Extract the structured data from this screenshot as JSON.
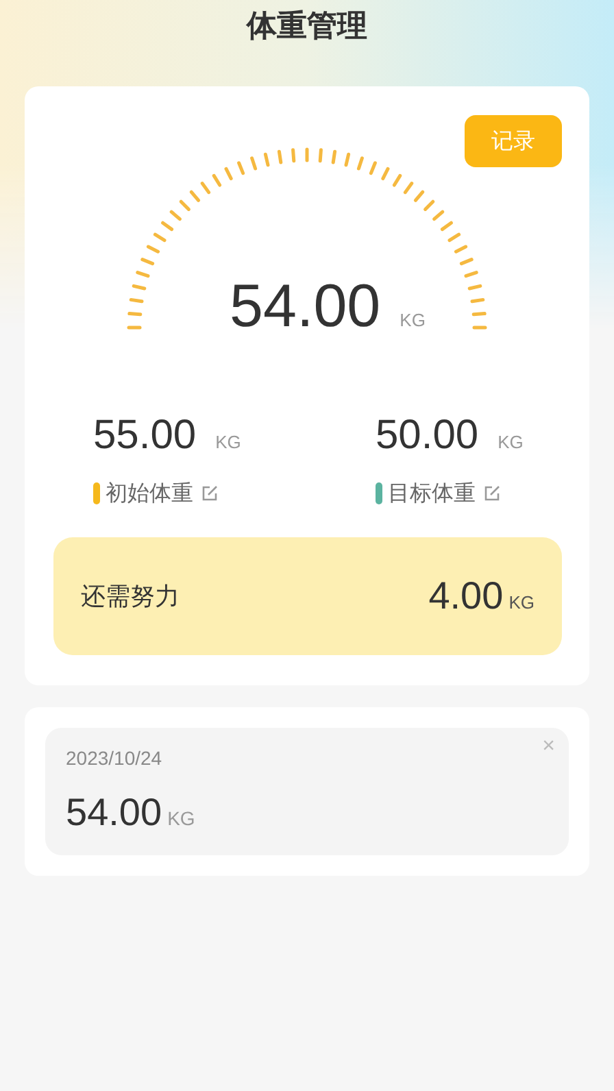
{
  "title": "体重管理",
  "record_button": "记录",
  "current": {
    "value": "54.00",
    "unit": "KG"
  },
  "stats": [
    {
      "value": "55.00",
      "unit": "KG",
      "label": "初始体重",
      "color": "#f5b81c"
    },
    {
      "value": "50.00",
      "unit": "KG",
      "label": "目标体重",
      "color": "#5bb3a0"
    }
  ],
  "remaining": {
    "label": "还需努力",
    "value": "4.00",
    "unit": "KG"
  },
  "history": [
    {
      "date": "2023/10/24",
      "value": "54.00",
      "unit": "KG",
      "close": "×"
    }
  ]
}
